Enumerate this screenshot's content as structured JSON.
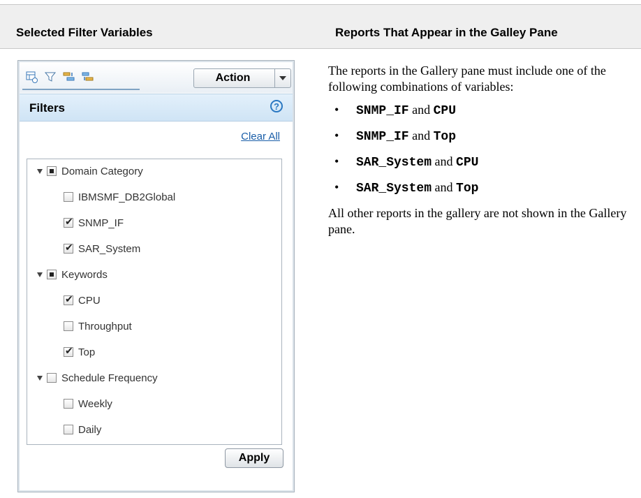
{
  "table": {
    "header_left": "Selected Filter Variables",
    "header_right": "Reports That Appear in the Galley Pane"
  },
  "panel": {
    "toolbar": {
      "icons": [
        "data-source-icon",
        "filter-icon",
        "sort-ascending-icon",
        "sort-descending-icon"
      ],
      "action_label": "Action"
    },
    "filters_title": "Filters",
    "help_label": "?",
    "clear_all": "Clear All",
    "tree": [
      {
        "label": "Domain Category",
        "state": "partial",
        "children": [
          {
            "label": "IBMSMF_DB2Global",
            "checked": false
          },
          {
            "label": "SNMP_IF",
            "checked": true
          },
          {
            "label": "SAR_System",
            "checked": true
          }
        ]
      },
      {
        "label": "Keywords",
        "state": "partial",
        "children": [
          {
            "label": "CPU",
            "checked": true
          },
          {
            "label": "Throughput",
            "checked": false
          },
          {
            "label": "Top",
            "checked": true
          }
        ]
      },
      {
        "label": "Schedule Frequency",
        "state": "unchecked",
        "children": [
          {
            "label": "Weekly",
            "checked": false
          },
          {
            "label": "Daily",
            "checked": false
          }
        ]
      }
    ],
    "apply_label": "Apply"
  },
  "description": {
    "intro": "The reports in the Gallery pane must include one of the following combinations of variables:",
    "combinations": [
      {
        "a": "SNMP_IF",
        "joiner": "and",
        "b": "CPU"
      },
      {
        "a": "SNMP_IF",
        "joiner": "and",
        "b": "Top"
      },
      {
        "a": "SAR_System",
        "joiner": "and",
        "b": "CPU"
      },
      {
        "a": "SAR_System",
        "joiner": "and",
        "b": "Top"
      }
    ],
    "bullet": "•",
    "outro": "All other reports in the gallery are not shown in the Gallery pane."
  },
  "colors": {
    "header_bg": "#efefef",
    "link": "#1a5ea8",
    "filters_bar": "#d6e8f7",
    "help_icon": "#2b78c2"
  }
}
